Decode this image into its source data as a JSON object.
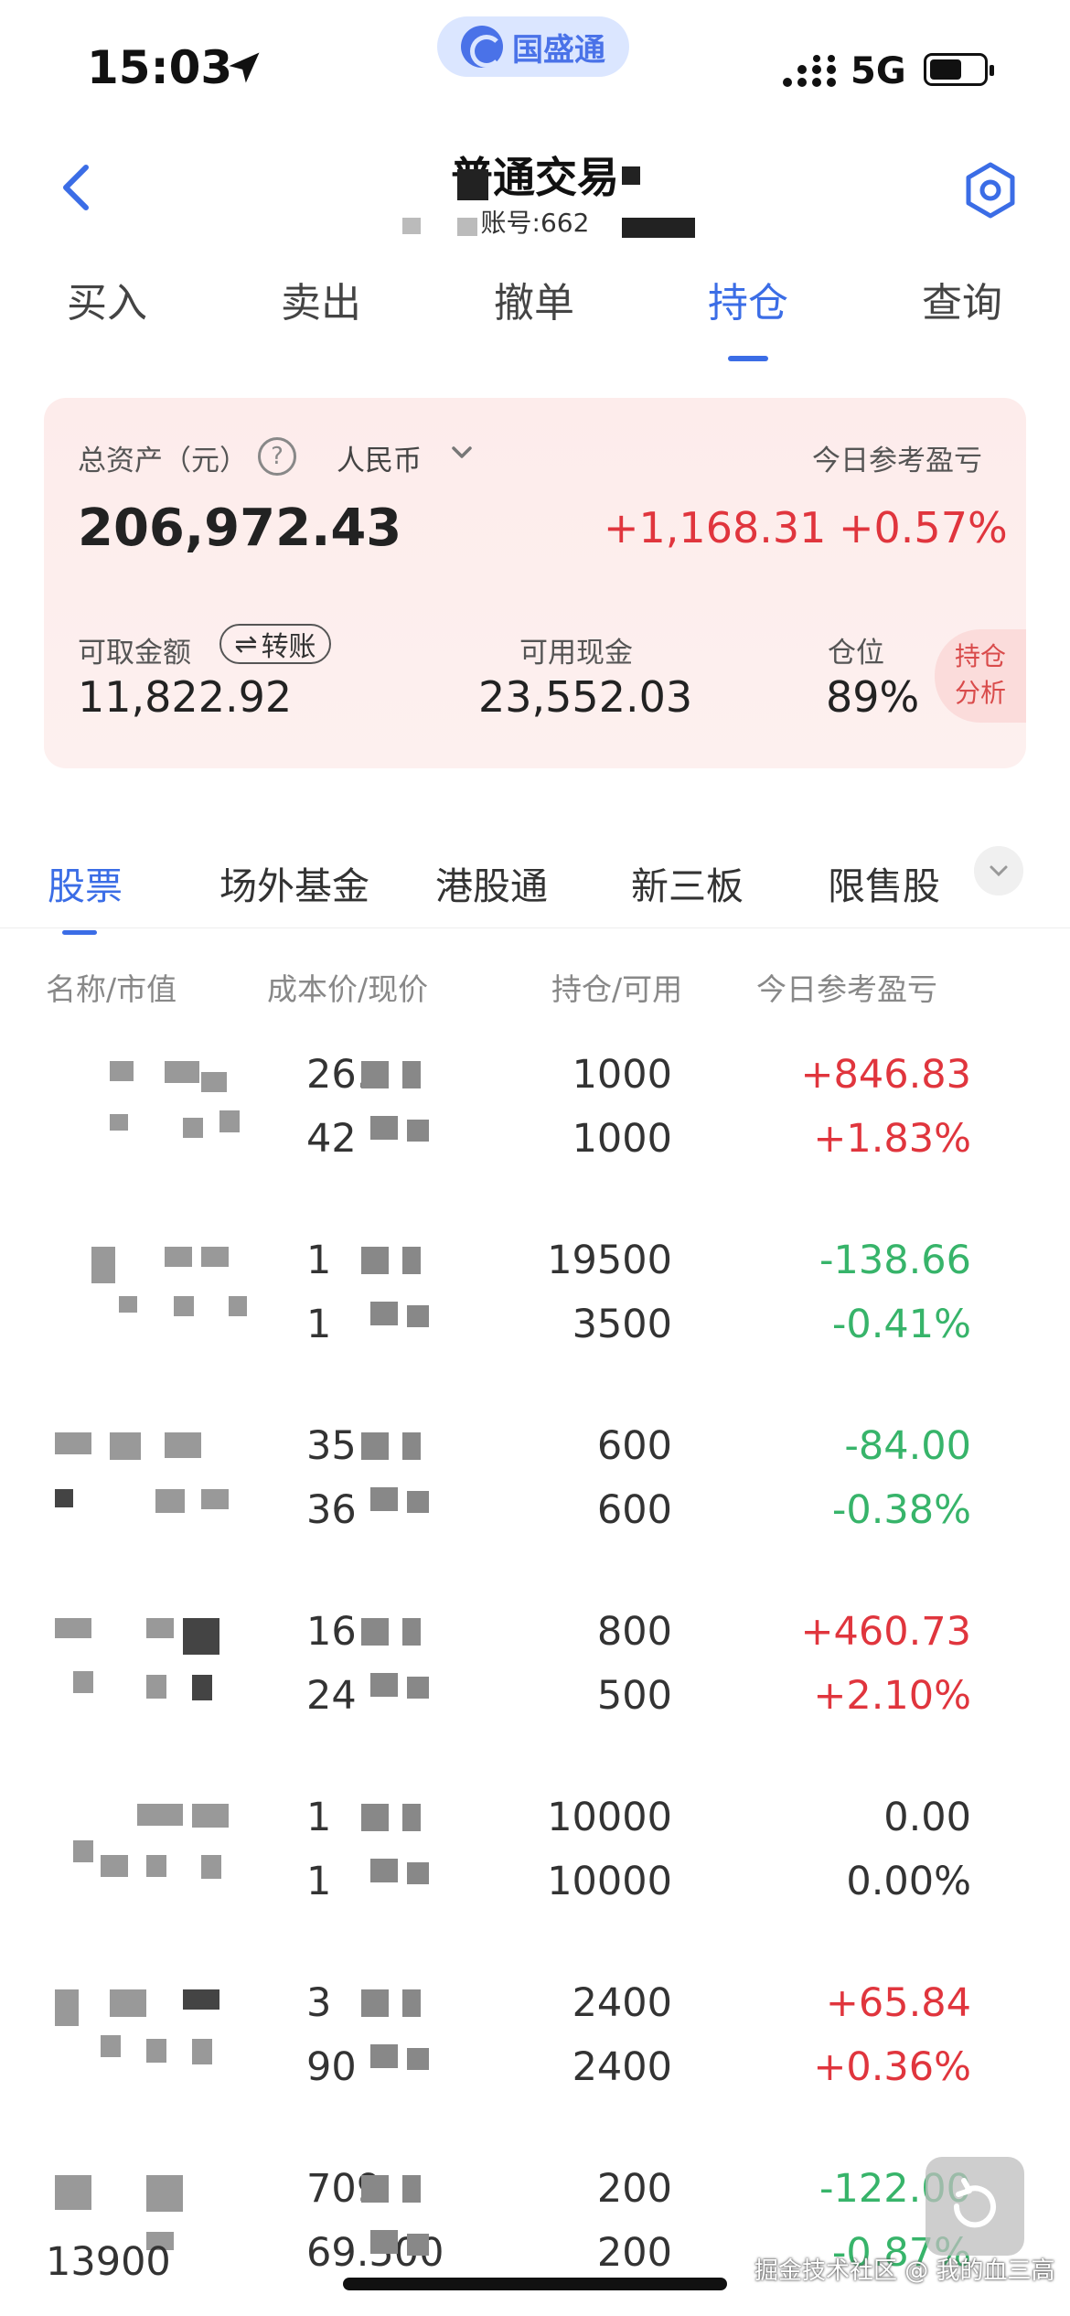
{
  "status_bar": {
    "time": "15:03",
    "app_badge": "国盛通",
    "network": "5G"
  },
  "header": {
    "title": "普通交易",
    "account_label": "账号:662"
  },
  "main_tabs": [
    {
      "label": "买入"
    },
    {
      "label": "卖出"
    },
    {
      "label": "撤单"
    },
    {
      "label": "持仓",
      "active": true
    },
    {
      "label": "查询"
    }
  ],
  "asset": {
    "total_label": "总资产（元）",
    "currency": "人民币",
    "total_value": "206,972.43",
    "today_pl_label": "今日参考盈亏",
    "today_pl": "+1,168.31",
    "today_pl_pct": "+0.57%",
    "withdrawable_label": "可取金额",
    "withdrawable": "11,822.92",
    "transfer_label": "转账",
    "cash_label": "可用现金",
    "cash": "23,552.03",
    "position_label": "仓位",
    "position": "89%",
    "analysis_label_1": "持仓",
    "analysis_label_2": "分析"
  },
  "sub_tabs": [
    {
      "label": "股票",
      "active": true
    },
    {
      "label": "场外基金"
    },
    {
      "label": "港股通"
    },
    {
      "label": "新三板"
    },
    {
      "label": "限售股"
    }
  ],
  "columns": {
    "name": "名称/市值",
    "price": "成本价/现价",
    "qty": "持仓/可用",
    "pl": "今日参考盈亏"
  },
  "holdings": [
    {
      "price1": "26.",
      "price2": "42",
      "qty": "1000",
      "avail": "1000",
      "pl": "+846.83",
      "pct": "+1.83%",
      "trend": "up"
    },
    {
      "price1": "1",
      "price2": "1",
      "qty": "19500",
      "avail": "3500",
      "pl": "-138.66",
      "pct": "-0.41%",
      "trend": "down"
    },
    {
      "price1": "35",
      "price2": "36",
      "qty": "600",
      "avail": "600",
      "pl": "-84.00",
      "pct": "-0.38%",
      "trend": "down"
    },
    {
      "price1": "16",
      "price2": "24",
      "qty": "800",
      "avail": "500",
      "pl": "+460.73",
      "pct": "+2.10%",
      "trend": "up"
    },
    {
      "price1": "1",
      "price2": "1",
      "qty": "10000",
      "avail": "10000",
      "pl": "0.00",
      "pct": "0.00%",
      "trend": "flat"
    },
    {
      "price1": "3",
      "price2": "90",
      "qty": "2400",
      "avail": "2400",
      "pl": "+65.84",
      "pct": "+0.36%",
      "trend": "up"
    },
    {
      "name_value": "13900",
      "price1": "709",
      "price2": "69.500",
      "qty": "200",
      "avail": "200",
      "pl": "-122.00",
      "pct": "-0.87%",
      "trend": "down"
    }
  ],
  "watermark": "掘金技术社区 @ 我的血三高",
  "colors": {
    "accent": "#3b6de6",
    "up": "#e0353d",
    "down": "#37b46a"
  }
}
